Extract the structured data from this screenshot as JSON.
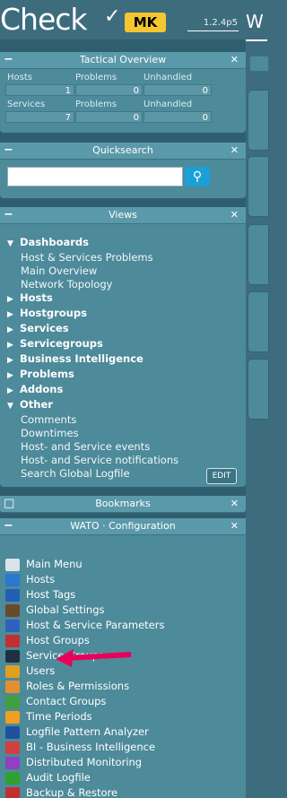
{
  "app": {
    "logo_text": "Check",
    "logo_badge": "MK",
    "version": "1.2.4p5",
    "right_title": "W"
  },
  "tactical": {
    "title": "Tactical Overview",
    "headers": [
      "Hosts",
      "Problems",
      "Unhandled"
    ],
    "hosts": [
      "1",
      "0",
      "0"
    ],
    "services_headers": [
      "Services",
      "Problems",
      "Unhandled"
    ],
    "services": [
      "7",
      "0",
      "0"
    ]
  },
  "quicksearch": {
    "title": "Quicksearch",
    "value": ""
  },
  "views": {
    "title": "Views",
    "dashboards": {
      "label": "Dashboards",
      "items": [
        "Host & Services Problems",
        "Main Overview",
        "Network Topology"
      ]
    },
    "collapsed": [
      "Hosts",
      "Hostgroups",
      "Services",
      "Servicegroups",
      "Business Intelligence",
      "Problems",
      "Addons"
    ],
    "other": {
      "label": "Other",
      "items": [
        "Comments",
        "Downtimes",
        "Host- and Service events",
        "Host- and Service notifications",
        "Search Global Logfile"
      ]
    },
    "edit": "EDIT"
  },
  "bookmarks": {
    "title": "Bookmarks"
  },
  "wato": {
    "title": "WATO · Configuration",
    "items": [
      {
        "label": "Main Menu",
        "icon": "home-icon",
        "color": "#d8e4ea"
      },
      {
        "label": "Hosts",
        "icon": "folder-icon",
        "color": "#2a78d0"
      },
      {
        "label": "Host Tags",
        "icon": "tag-icon",
        "color": "#1f5fb8"
      },
      {
        "label": "Global Settings",
        "icon": "settings-icon",
        "color": "#6b4a2a"
      },
      {
        "label": "Host & Service Parameters",
        "icon": "parameters-icon",
        "color": "#3060c0"
      },
      {
        "label": "Host Groups",
        "icon": "host-groups-icon",
        "color": "#c03030"
      },
      {
        "label": "Service Groups",
        "icon": "service-groups-icon",
        "color": "#203040"
      },
      {
        "label": "Users",
        "icon": "users-icon",
        "color": "#e0a020"
      },
      {
        "label": "Roles & Permissions",
        "icon": "roles-icon",
        "color": "#e09030"
      },
      {
        "label": "Contact Groups",
        "icon": "contact-groups-icon",
        "color": "#40a040"
      },
      {
        "label": "Time Periods",
        "icon": "clock-icon",
        "color": "#f0a020"
      },
      {
        "label": "Logfile Pattern Analyzer",
        "icon": "logfile-icon",
        "color": "#2050a0"
      },
      {
        "label": "BI - Business Intelligence",
        "icon": "bi-icon",
        "color": "#d04040"
      },
      {
        "label": "Distributed Monitoring",
        "icon": "distributed-icon",
        "color": "#9040c0"
      },
      {
        "label": "Audit Logfile",
        "icon": "audit-icon",
        "color": "#30a030"
      },
      {
        "label": "Backup & Restore",
        "icon": "backup-icon",
        "color": "#c03030"
      }
    ]
  },
  "annotation": {
    "color": "#e8005a"
  }
}
